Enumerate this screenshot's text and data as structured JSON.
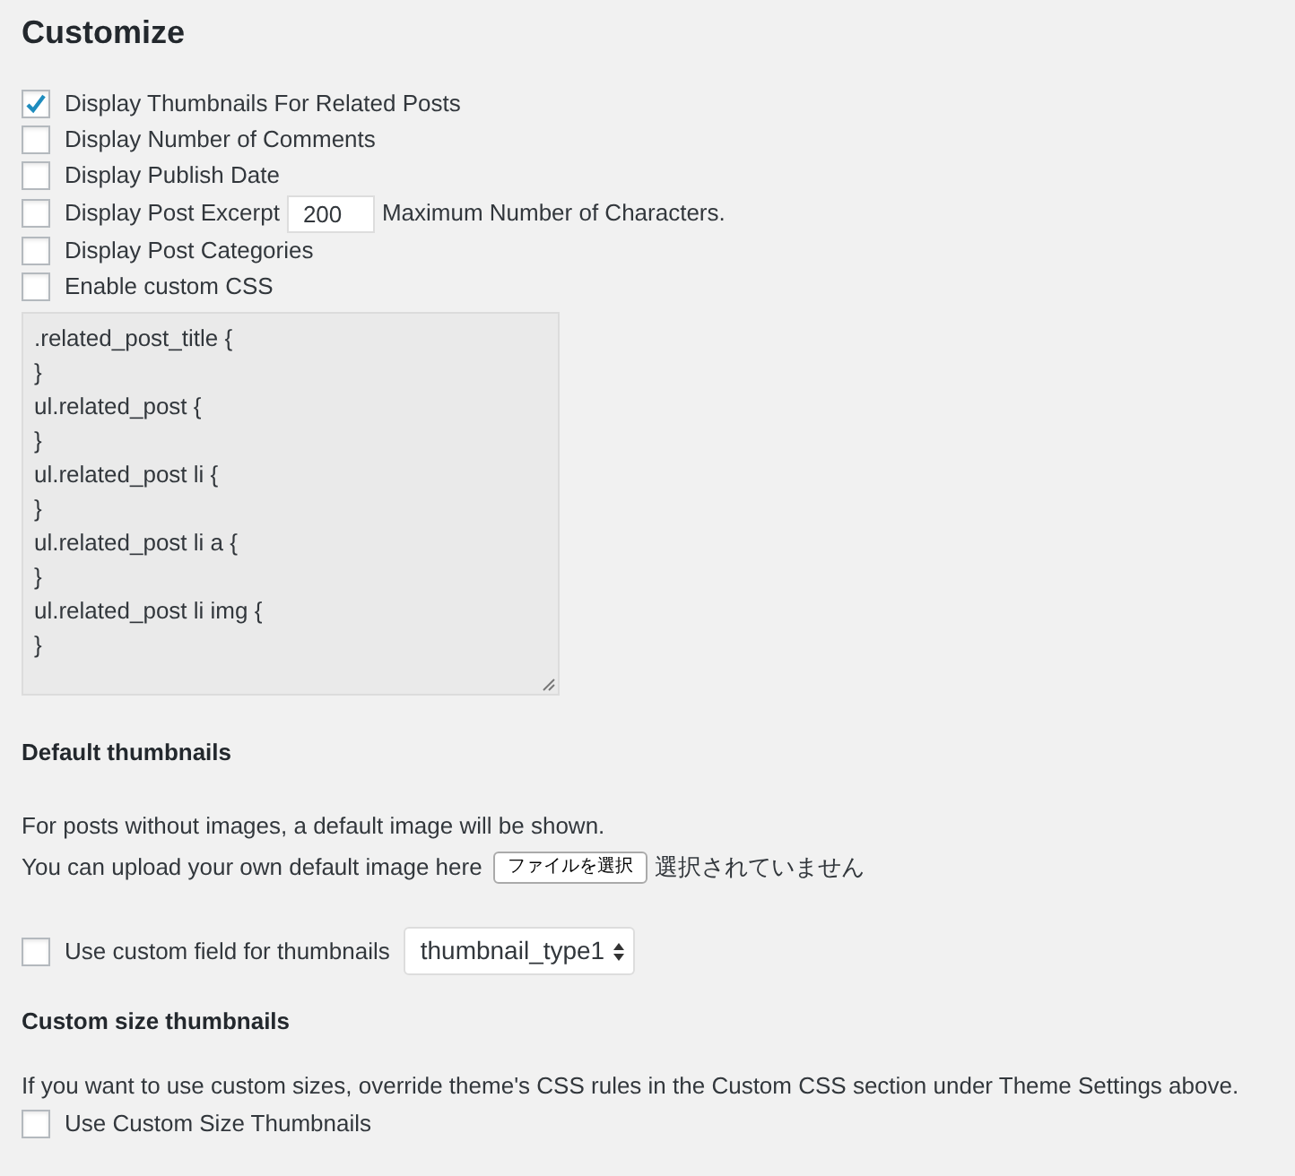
{
  "title": "Customize",
  "options": [
    {
      "kind": "plain",
      "label": "Display Thumbnails For Related Posts",
      "checked": true
    },
    {
      "kind": "plain",
      "label": "Display Number of Comments",
      "checked": false
    },
    {
      "kind": "plain",
      "label": "Display Publish Date",
      "checked": false
    },
    {
      "kind": "excerpt",
      "label": "Display Post Excerpt",
      "checked": false,
      "value": "200",
      "suffix": "Maximum Number of Characters."
    },
    {
      "kind": "plain",
      "label": "Display Post Categories",
      "checked": false
    },
    {
      "kind": "plain",
      "label": "Enable custom CSS",
      "checked": false
    }
  ],
  "custom_css": {
    "lines": [
      ".related_post_title {",
      "}",
      "ul.related_post {",
      "}",
      "ul.related_post li {",
      "}",
      "ul.related_post li a {",
      "}",
      "ul.related_post li img {",
      "}"
    ]
  },
  "default_thumbnails": {
    "heading": "Default thumbnails",
    "description": "For posts without images, a default image will be shown.",
    "upload_label": "You can upload your own default image here",
    "file_button": "ファイルを選択",
    "file_status": "選択されていません"
  },
  "custom_field": {
    "label": "Use custom field for thumbnails",
    "checked": false,
    "select_value": "thumbnail_type1"
  },
  "custom_size": {
    "heading": "Custom size thumbnails",
    "description": "If you want to use custom sizes, override theme's CSS rules in the Custom CSS section under Theme Settings above.",
    "label": "Use Custom Size Thumbnails",
    "checked": false
  }
}
